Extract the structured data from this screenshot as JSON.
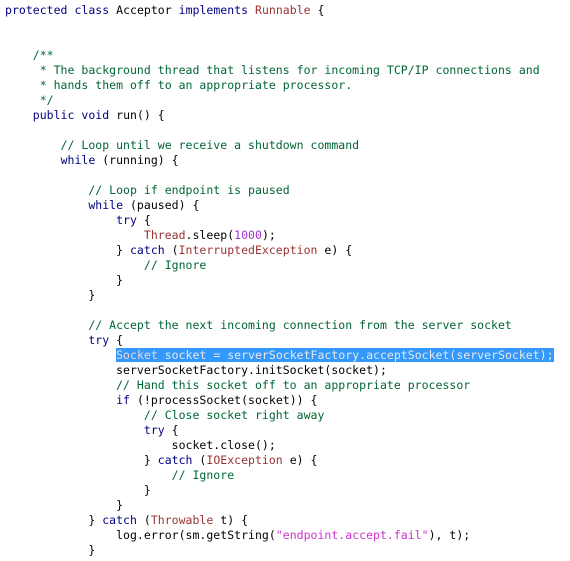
{
  "editor": {
    "language": "java",
    "background_color": "#ffffff",
    "selection_color": "#3399FF",
    "selection_text_color": "#E8E8E8",
    "syntax_colors": {
      "keyword": "#000080",
      "type": "#993333",
      "comment": "#006633",
      "string": "#CC33CC",
      "number": "#9933CC",
      "plain": "#000000"
    }
  },
  "lines": [
    {
      "id": "line-1",
      "indent": 0,
      "selected": false,
      "tokens": [
        {
          "t": "protected",
          "c": "kw"
        },
        {
          "t": " ",
          "c": "plain"
        },
        {
          "t": "class",
          "c": "kw"
        },
        {
          "t": " ",
          "c": "plain"
        },
        {
          "t": "Acceptor",
          "c": "plain"
        },
        {
          "t": " ",
          "c": "plain"
        },
        {
          "t": "implements",
          "c": "kw"
        },
        {
          "t": " ",
          "c": "plain"
        },
        {
          "t": "Runnable",
          "c": "type"
        },
        {
          "t": " {",
          "c": "plain"
        }
      ]
    },
    {
      "id": "line-2",
      "indent": 0,
      "selected": false,
      "tokens": []
    },
    {
      "id": "line-3",
      "indent": 0,
      "selected": false,
      "tokens": []
    },
    {
      "id": "line-4",
      "indent": 0,
      "selected": false,
      "tokens": [
        {
          "t": "    /**",
          "c": "cmt"
        }
      ]
    },
    {
      "id": "line-5",
      "indent": 0,
      "selected": false,
      "tokens": [
        {
          "t": "     * The background thread that listens for incoming TCP/IP connections and",
          "c": "cmt"
        }
      ]
    },
    {
      "id": "line-6",
      "indent": 0,
      "selected": false,
      "tokens": [
        {
          "t": "     * hands them off to an appropriate processor.",
          "c": "cmt"
        }
      ]
    },
    {
      "id": "line-7",
      "indent": 0,
      "selected": false,
      "tokens": [
        {
          "t": "     */",
          "c": "cmt"
        }
      ]
    },
    {
      "id": "line-8",
      "indent": 0,
      "selected": false,
      "tokens": [
        {
          "t": "    ",
          "c": "plain"
        },
        {
          "t": "public",
          "c": "kw"
        },
        {
          "t": " ",
          "c": "plain"
        },
        {
          "t": "void",
          "c": "kw"
        },
        {
          "t": " run() {",
          "c": "plain"
        }
      ]
    },
    {
      "id": "line-9",
      "indent": 0,
      "selected": false,
      "tokens": []
    },
    {
      "id": "line-10",
      "indent": 0,
      "selected": false,
      "tokens": [
        {
          "t": "        // Loop until we receive a shutdown command",
          "c": "cmt"
        }
      ]
    },
    {
      "id": "line-11",
      "indent": 0,
      "selected": false,
      "tokens": [
        {
          "t": "        ",
          "c": "plain"
        },
        {
          "t": "while",
          "c": "kw"
        },
        {
          "t": " (running) {",
          "c": "plain"
        }
      ]
    },
    {
      "id": "line-12",
      "indent": 0,
      "selected": false,
      "tokens": []
    },
    {
      "id": "line-13",
      "indent": 0,
      "selected": false,
      "tokens": [
        {
          "t": "            // Loop if endpoint is paused",
          "c": "cmt"
        }
      ]
    },
    {
      "id": "line-14",
      "indent": 0,
      "selected": false,
      "tokens": [
        {
          "t": "            ",
          "c": "plain"
        },
        {
          "t": "while",
          "c": "kw"
        },
        {
          "t": " (paused) {",
          "c": "plain"
        }
      ]
    },
    {
      "id": "line-15",
      "indent": 0,
      "selected": false,
      "tokens": [
        {
          "t": "                ",
          "c": "plain"
        },
        {
          "t": "try",
          "c": "kw"
        },
        {
          "t": " {",
          "c": "plain"
        }
      ]
    },
    {
      "id": "line-16",
      "indent": 0,
      "selected": false,
      "tokens": [
        {
          "t": "                    ",
          "c": "plain"
        },
        {
          "t": "Thread",
          "c": "type"
        },
        {
          "t": ".sleep(",
          "c": "plain"
        },
        {
          "t": "1000",
          "c": "num"
        },
        {
          "t": ");",
          "c": "plain"
        }
      ]
    },
    {
      "id": "line-17",
      "indent": 0,
      "selected": false,
      "tokens": [
        {
          "t": "                } ",
          "c": "plain"
        },
        {
          "t": "catch",
          "c": "kw"
        },
        {
          "t": " (",
          "c": "plain"
        },
        {
          "t": "InterruptedException",
          "c": "type"
        },
        {
          "t": " e) {",
          "c": "plain"
        }
      ]
    },
    {
      "id": "line-18",
      "indent": 0,
      "selected": false,
      "tokens": [
        {
          "t": "                    // Ignore",
          "c": "cmt"
        }
      ]
    },
    {
      "id": "line-19",
      "indent": 0,
      "selected": false,
      "tokens": [
        {
          "t": "                }",
          "c": "plain"
        }
      ]
    },
    {
      "id": "line-20",
      "indent": 0,
      "selected": false,
      "tokens": [
        {
          "t": "            }",
          "c": "plain"
        }
      ]
    },
    {
      "id": "line-21",
      "indent": 0,
      "selected": false,
      "tokens": []
    },
    {
      "id": "line-22",
      "indent": 0,
      "selected": false,
      "tokens": [
        {
          "t": "            // Accept the next incoming connection from the server socket",
          "c": "cmt"
        }
      ]
    },
    {
      "id": "line-23",
      "indent": 0,
      "selected": false,
      "tokens": [
        {
          "t": "            ",
          "c": "plain"
        },
        {
          "t": "try",
          "c": "kw"
        },
        {
          "t": " {",
          "c": "plain"
        }
      ]
    },
    {
      "id": "line-24",
      "indent": 0,
      "selected": true,
      "prefix": "                ",
      "tokens": [
        {
          "t": "Socket",
          "c": "type"
        },
        {
          "t": " socket = serverSocketFactory.acceptSocket(serverSocket);",
          "c": "plain"
        }
      ]
    },
    {
      "id": "line-25",
      "indent": 0,
      "selected": false,
      "tokens": [
        {
          "t": "                serverSocketFactory.initSocket(socket);",
          "c": "plain"
        }
      ]
    },
    {
      "id": "line-26",
      "indent": 0,
      "selected": false,
      "tokens": [
        {
          "t": "                // Hand this socket off to an appropriate processor",
          "c": "cmt"
        }
      ]
    },
    {
      "id": "line-27",
      "indent": 0,
      "selected": false,
      "tokens": [
        {
          "t": "                ",
          "c": "plain"
        },
        {
          "t": "if",
          "c": "kw"
        },
        {
          "t": " (!processSocket(socket)) {",
          "c": "plain"
        }
      ]
    },
    {
      "id": "line-28",
      "indent": 0,
      "selected": false,
      "tokens": [
        {
          "t": "                    // Close socket right away",
          "c": "cmt"
        }
      ]
    },
    {
      "id": "line-29",
      "indent": 0,
      "selected": false,
      "tokens": [
        {
          "t": "                    ",
          "c": "plain"
        },
        {
          "t": "try",
          "c": "kw"
        },
        {
          "t": " {",
          "c": "plain"
        }
      ]
    },
    {
      "id": "line-30",
      "indent": 0,
      "selected": false,
      "tokens": [
        {
          "t": "                        socket.close();",
          "c": "plain"
        }
      ]
    },
    {
      "id": "line-31",
      "indent": 0,
      "selected": false,
      "tokens": [
        {
          "t": "                    } ",
          "c": "plain"
        },
        {
          "t": "catch",
          "c": "kw"
        },
        {
          "t": " (",
          "c": "plain"
        },
        {
          "t": "IOException",
          "c": "type"
        },
        {
          "t": " e) {",
          "c": "plain"
        }
      ]
    },
    {
      "id": "line-32",
      "indent": 0,
      "selected": false,
      "tokens": [
        {
          "t": "                        // Ignore",
          "c": "cmt"
        }
      ]
    },
    {
      "id": "line-33",
      "indent": 0,
      "selected": false,
      "tokens": [
        {
          "t": "                    }",
          "c": "plain"
        }
      ]
    },
    {
      "id": "line-34",
      "indent": 0,
      "selected": false,
      "tokens": [
        {
          "t": "                }",
          "c": "plain"
        }
      ]
    },
    {
      "id": "line-35",
      "indent": 0,
      "selected": false,
      "tokens": [
        {
          "t": "            } ",
          "c": "plain"
        },
        {
          "t": "catch",
          "c": "kw"
        },
        {
          "t": " (",
          "c": "plain"
        },
        {
          "t": "Throwable",
          "c": "type"
        },
        {
          "t": " t) {",
          "c": "plain"
        }
      ]
    },
    {
      "id": "line-36",
      "indent": 0,
      "selected": false,
      "tokens": [
        {
          "t": "                log.error(sm.getString(",
          "c": "plain"
        },
        {
          "t": "\"endpoint.accept.fail\"",
          "c": "str"
        },
        {
          "t": "), t);",
          "c": "plain"
        }
      ]
    },
    {
      "id": "line-37",
      "indent": 0,
      "selected": false,
      "tokens": [
        {
          "t": "            }",
          "c": "plain"
        }
      ]
    }
  ]
}
